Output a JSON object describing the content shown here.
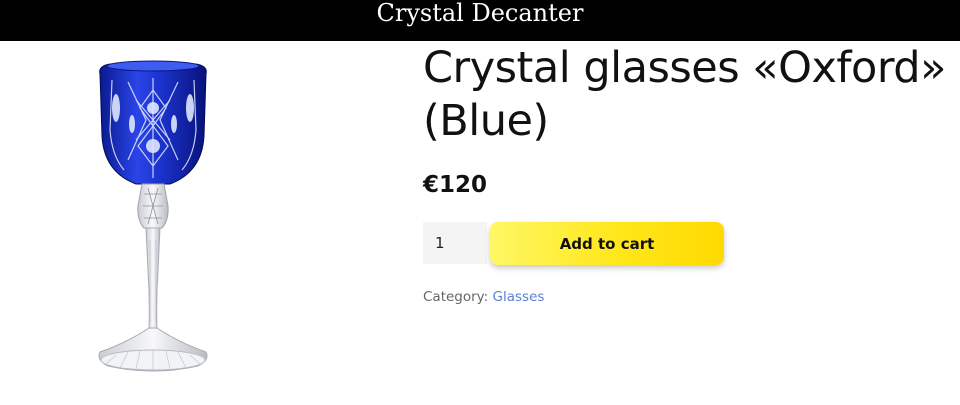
{
  "header": {
    "site_title": "Crystal Decanter"
  },
  "product": {
    "title": "Crystal glasses «Oxford» (Blue)",
    "price": "€120",
    "quantity": "1",
    "add_to_cart_label": "Add to cart",
    "category_label": "Category:",
    "category_link": "Glasses"
  },
  "colors": {
    "header_bg": "#000000",
    "button_gradient_start": "#fff766",
    "button_gradient_end": "#ffd900",
    "link": "#5b7fd6",
    "glass_blue": "#1a2fd0"
  },
  "icons": {
    "product_image": "blue-crystal-wine-glass"
  }
}
